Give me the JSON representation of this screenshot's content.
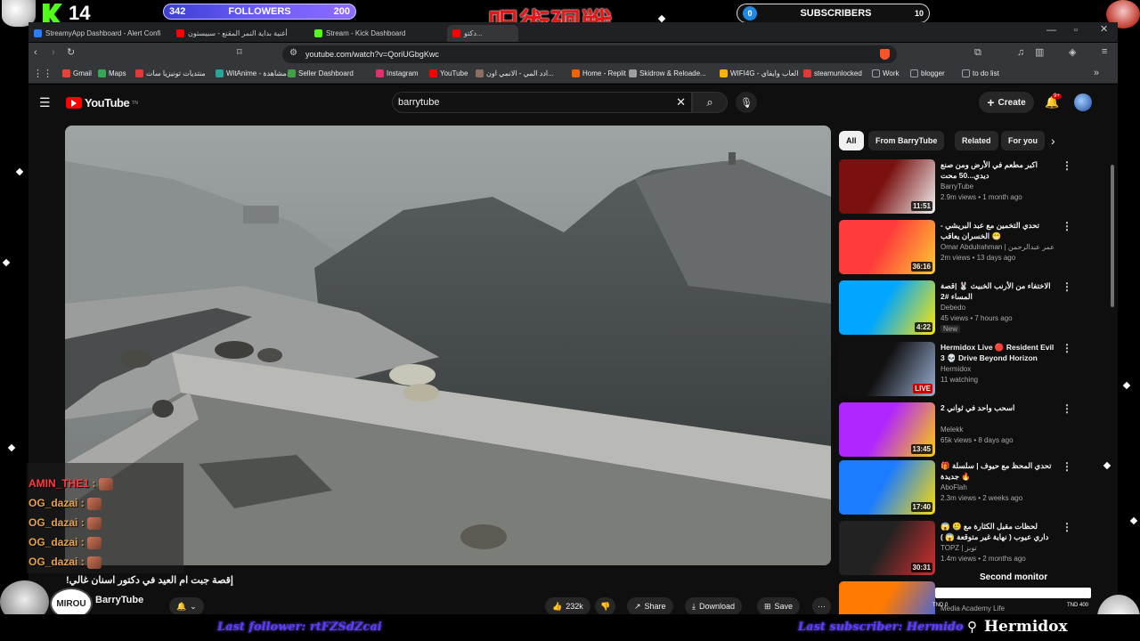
{
  "overlay": {
    "kick_count": "14",
    "followers_label": "FOLLOWERS",
    "followers_left": "342",
    "followers_right": "200",
    "subscribers_label": "SUBSCRIBERS",
    "subscribers_left": "0",
    "subscribers_right": "10",
    "title_glyphs": "呪術廻戦",
    "last_follower": "Last follower: rtFZSdZcai",
    "last_subscriber": "Last subscriber: Hermido",
    "brand": "Hermidox",
    "second_monitor": "Second monitor",
    "monitor_left": "TND 0",
    "monitor_right": "TND 400",
    "mirou": "MIROU"
  },
  "browser": {
    "tabs": [
      {
        "label": "StreamyApp Dashboard - Alert Confi",
        "color": "#2d7cff"
      },
      {
        "label": "أغنية بداية النمر المقنع - سبيستون",
        "color": "#ff0000"
      },
      {
        "label": "Stream - Kick Dashboard",
        "color": "#53fc18"
      },
      {
        "label": "دكتو...",
        "color": "#ff0000"
      }
    ],
    "url": "youtube.com/watch?v=QoriUGbgKwc",
    "bookmarks": [
      {
        "label": "Gmail",
        "color": "#ea4335"
      },
      {
        "label": "Maps",
        "color": "#34a853"
      },
      {
        "label": "منتديات تونيزيا سات",
        "color": "#e53935"
      },
      {
        "label": "WitAnime - مشاهدة...",
        "color": "#26a69a"
      },
      {
        "label": "Seller Dashboard",
        "color": "#43a047"
      },
      {
        "label": "Instagram",
        "color": "#e1306c"
      },
      {
        "label": "YouTube",
        "color": "#ff0000"
      },
      {
        "label": "ادد المي - الانمي اون...",
        "color": "#8d6e63"
      },
      {
        "label": "Home - Replit",
        "color": "#f26207"
      },
      {
        "label": "Skidrow & Reloade...",
        "color": "#9e9e9e"
      },
      {
        "label": "WIFI4G - العاب وايفاي",
        "color": "#ffb300"
      },
      {
        "label": "steamunlocked",
        "color": "#e53935"
      },
      {
        "label": "Work",
        "color": "#9aa0a6"
      },
      {
        "label": "blogger",
        "color": "#9aa0a6"
      },
      {
        "label": "to do list",
        "color": "#9aa0a6"
      }
    ]
  },
  "youtube": {
    "logo_text": "YouTube",
    "logo_sup": "TN",
    "search_value": "barrytube",
    "create_label": "Create",
    "notif_badge": "9+",
    "chips": [
      "All",
      "From BarryTube",
      "Related",
      "For you"
    ],
    "video_title": "إقصة جبت ام العيد في دكتور اسنان غالي!",
    "channel": "BarryTube",
    "likes": "232k",
    "share_label": "Share",
    "download_label": "Download",
    "save_label": "Save",
    "recommendations": [
      {
        "title": "اكبر مطعم في الأرض ومن صنع ديدي...50 محت",
        "channel": "BarryTube",
        "meta": "2.9m views • 1 month ago",
        "duration": "11:51",
        "c1": "#7a1010",
        "c2": "#f2f2f2"
      },
      {
        "title": "تحدي التخمين مع عبد البريشي - الخسران يعاقب 😁",
        "channel": "Omar Abdulrahman | عمر عبدالرحمن",
        "meta": "2m views • 13 days ago",
        "duration": "36:16",
        "c1": "#ff3b3b",
        "c2": "#ffcc33"
      },
      {
        "title": "الاختفاء من الأرنب الخبيث 🐰 |قصة المساء #2",
        "channel": "Debedo",
        "meta": "45 views • 7 hours ago",
        "duration": "4:22",
        "badge": "New",
        "c1": "#00a6ff",
        "c2": "#ffe600"
      },
      {
        "title": "Hermidox Live 🔴 Resident Evil 3 💀 Drive Beyond Horizon",
        "channel": "Hermidox",
        "meta": "11 watching",
        "duration": "LIVE",
        "c1": "#111111",
        "c2": "#9bb0d6"
      },
      {
        "title": "اسحب واحد في ثواني 2",
        "channel": "Melekk",
        "meta": "65k views • 8 days ago",
        "duration": "13:45",
        "c1": "#b026ff",
        "c2": "#ffd000"
      },
      {
        "title": "🎁 تحدي المحظ مع حيوف | سلسلة جديدة 🔥",
        "channel": "AboFlah",
        "meta": "2.3m views • 2 weeks ago",
        "duration": "17:40",
        "c1": "#1c7cff",
        "c2": "#ffdd00"
      },
      {
        "title": "😱 🥲 لحظات مقبل الكثارة مع داري عيوب ( نهاية غير متوقعة 😱 )",
        "channel": "TOPZ | توبز",
        "meta": "1.4m views • 2 months ago",
        "duration": "30:31",
        "c1": "#222222",
        "c2": "#d32f2f"
      },
      {
        "title": "",
        "channel": "Media Academy Life",
        "meta": "",
        "duration": "",
        "c1": "#ff7a00",
        "c2": "#2962ff"
      }
    ]
  },
  "chat": [
    {
      "user": "AMIN_THE1",
      "color": "#ff3b3b"
    },
    {
      "user": "OG_dazai",
      "color": "#e8a14a"
    },
    {
      "user": "OG_dazai",
      "color": "#e8a14a"
    },
    {
      "user": "OG_dazai",
      "color": "#e8a14a"
    },
    {
      "user": "OG_dazai",
      "color": "#e8a14a"
    }
  ]
}
